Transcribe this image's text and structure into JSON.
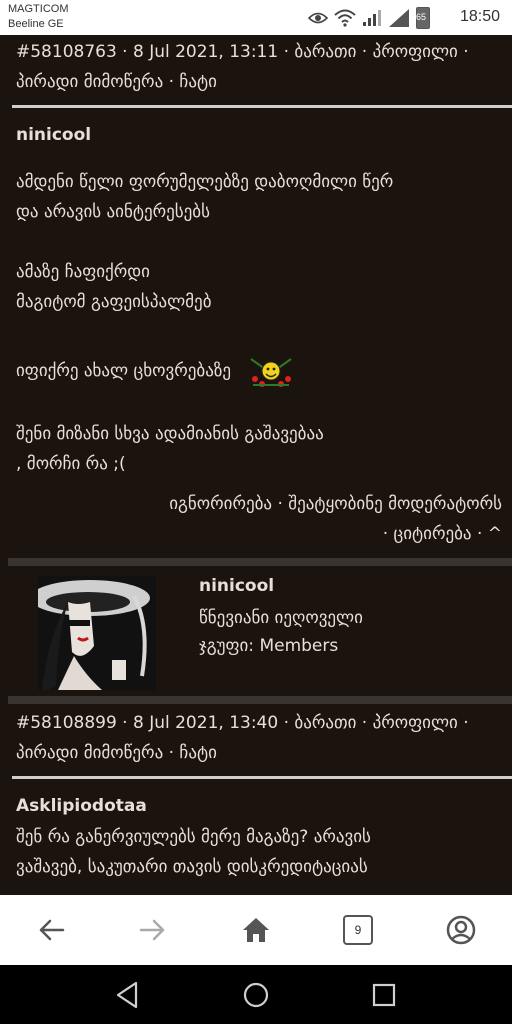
{
  "status_bar": {
    "carrier": "MAGTICOM",
    "carrier2": "Beeline GE",
    "battery": "65",
    "time": "18:50"
  },
  "post1": {
    "meta_line1": "#58108763 · 8 Jul 2021, 13:11 · ბარათი · პროფილი ·",
    "meta_line2": "პირადი მიმოწერა · ჩატი",
    "username": "ninicool",
    "line1": "ამდენი წელი ფორუმელებზე დაბოღმილი წერ",
    "line2": "და არავის აინტერესებს",
    "line3": "ამაზე ჩაფიქრდი",
    "line4": "მაგიტომ გაფეისპალმებ",
    "line5": "იფიქრე ახალ ცხოვრებაზე",
    "line6": "შენი მიზანი სხვა ადამიანის გაშავებაა",
    "line7": ", მორჩი რა ;(",
    "actions1": "იგნორირება · შეატყობინე მოდერატორს",
    "actions2": "· ციტირება · ^"
  },
  "profile": {
    "name": "ninicool",
    "rank": "წნევიანი იეღოველი",
    "group": "ჯგუფი: Members"
  },
  "post2": {
    "meta_line1": "#58108899 · 8 Jul 2021, 13:40 · ბარათი · პროფილი ·",
    "meta_line2": "პირადი მიმოწერა · ჩატი",
    "username": "Asklipiodotaa",
    "line1": "შენ რა განერვიულებს მერე მაგაზე? არავის",
    "line2": "ვაშავებ, საკუთარი თავის დისკრედიტაციას"
  },
  "browser_nav": {
    "tab_count": "9"
  },
  "colors": {
    "page_bg": "#1b140e",
    "text": "#e6e0d8",
    "divider": "#cfcfcf",
    "separator": "#3a3430",
    "chrome_white": "#ffffff",
    "system_nav": "#000000"
  }
}
